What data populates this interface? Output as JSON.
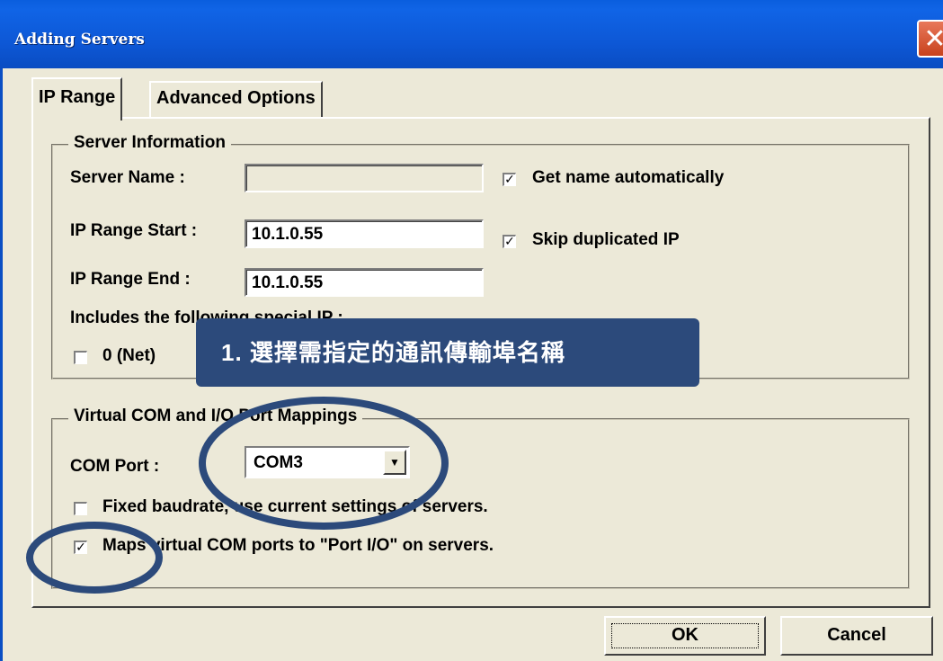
{
  "window": {
    "title": "Adding Servers",
    "close_glyph": "✕"
  },
  "tabs": [
    {
      "label": "IP Range",
      "active": true
    },
    {
      "label": "Advanced Options",
      "active": false
    }
  ],
  "server_info": {
    "legend": "Server Information",
    "server_name_label": "Server Name :",
    "server_name_value": "",
    "ip_start_label": "IP Range Start :",
    "ip_start_value": "10.1.0.55",
    "ip_end_label": "IP Range End :",
    "ip_end_value": "10.1.0.55",
    "get_name_auto_label": "Get name automatically",
    "get_name_auto_checked": true,
    "skip_dup_label": "Skip duplicated IP",
    "skip_dup_checked": true,
    "special_ip_label": "Includes the following special IP :",
    "net_label": "0 (Net)",
    "net_checked": false,
    "hidden_checked": true,
    "check_glyph": "✓"
  },
  "vcom": {
    "legend": "Virtual COM and I/O Port Mappings",
    "com_port_label": "COM Port :",
    "com_port_value": "COM3",
    "dropdown_glyph": "▼",
    "fixed_baud_label": "Fixed baudrate, use current settings of servers.",
    "fixed_baud_checked": false,
    "maps_label": "Maps virtual COM ports to \"Port I/O\" on servers.",
    "maps_checked": true
  },
  "buttons": {
    "ok": "OK",
    "cancel": "Cancel"
  },
  "annotation": {
    "text": "1. 選擇需指定的通訊傳輸埠名稱",
    "box_color": "#2c4a7b",
    "circle_color": "#2c4a7b"
  }
}
